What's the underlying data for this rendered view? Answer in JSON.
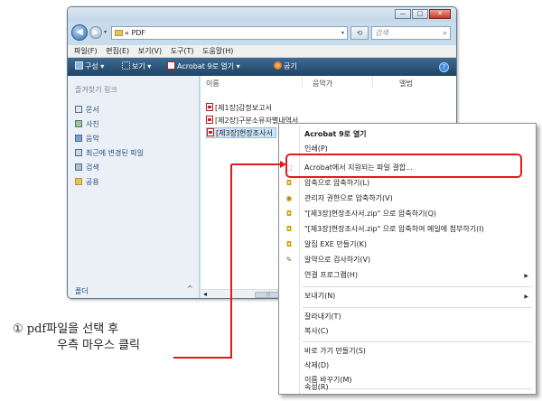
{
  "window": {
    "address": "« PDF",
    "search_placeholder": "검색",
    "buttons": {
      "minimize": "—",
      "maximize": "□",
      "close": "✕"
    }
  },
  "menubar": [
    "파일(F)",
    "편집(E)",
    "보기(V)",
    "도구(T)",
    "도움말(H)"
  ],
  "toolbar": {
    "organize": "구성 ▾",
    "views": "보기 ▾",
    "acrobat_open": "Acrobat 9로 열기 ▾",
    "burn": "굽기"
  },
  "nav_pane": {
    "heading": "즐겨찾기 링크",
    "items": [
      "문서",
      "사진",
      "음악",
      "최근에 변경된 파일",
      "검색",
      "공용"
    ],
    "folders_label": "폴더"
  },
  "content": {
    "columns": [
      "이름",
      "음악가",
      "앨범"
    ],
    "files": [
      "[제1장]감정보고서",
      "[제2장]구분소유자별내역서",
      "[제3장]현장조사서"
    ]
  },
  "context_menu": {
    "items": [
      "Acrobat 9로 열기",
      "인쇄(P)",
      "Acrobat에서 지원되는 파일 결합...",
      "압축으로 압축하기(L)",
      "관리자 권한으로 압축하기(V)",
      "\"[제3장]현장조사서.zip\" 으로 압축하기(Q)",
      "\"[제3장]현장조사서.zip\" 으로 압축하여 메일에 첨부하기(I)",
      "알집 EXE 만들기(K)",
      "알약으로 검사하기(V)",
      "연결 프로그램(H)",
      "보내기(N)",
      "잘라내기(T)",
      "복사(C)",
      "바로 가기 만들기(S)",
      "삭제(D)",
      "이름 바꾸기(M)",
      "속성(R)"
    ]
  },
  "callout": {
    "line1": "① pdf파일을 선택 후",
    "line2": "우측 마우스 클릭"
  },
  "colors": {
    "highlight": "#e21b1b",
    "toolbar": "#2c5478",
    "selection": "#cde4f7"
  }
}
